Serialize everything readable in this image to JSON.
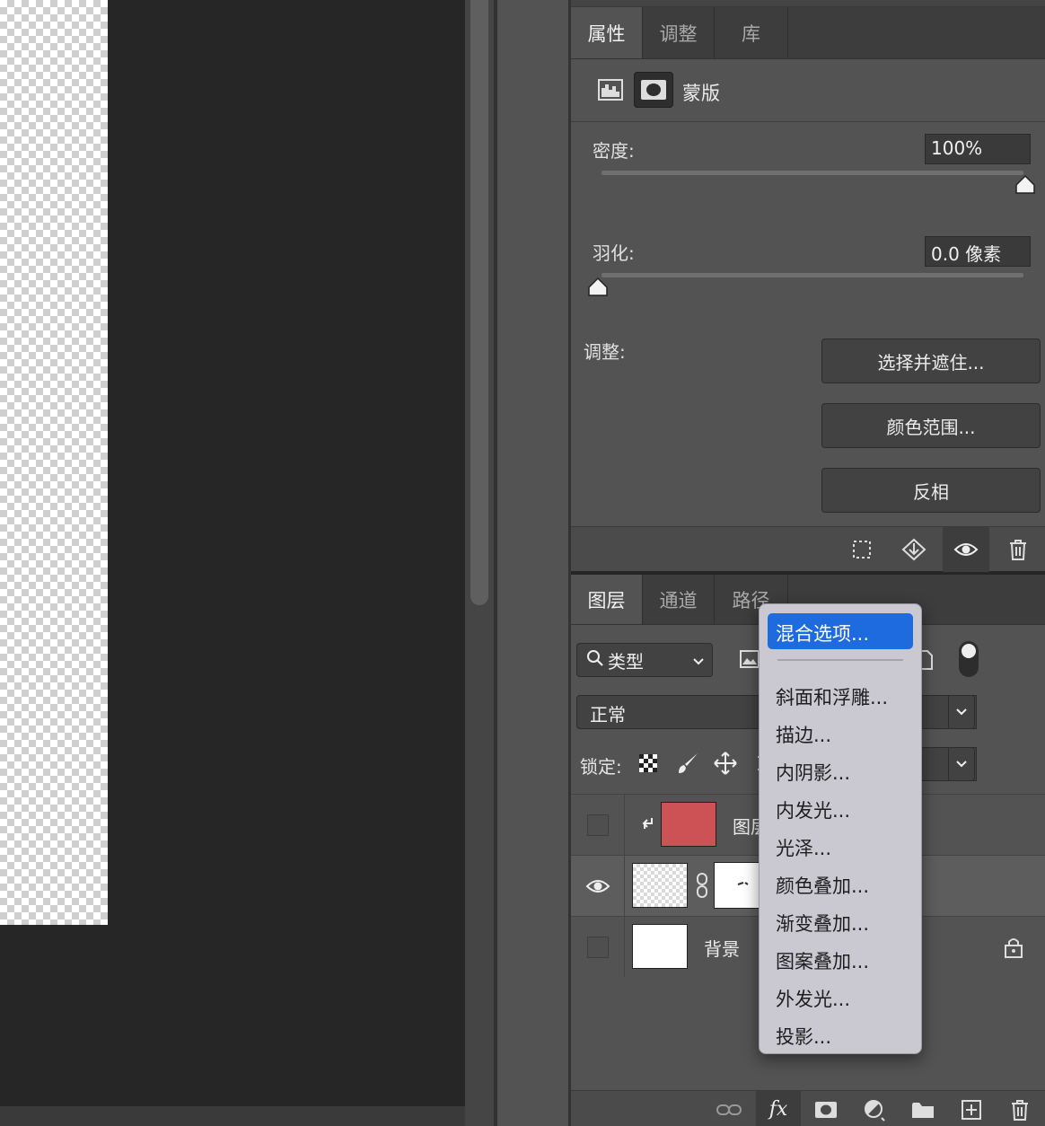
{
  "properties": {
    "tabs": [
      "属性",
      "调整",
      "库"
    ],
    "mode_label": "蒙版",
    "density_label": "密度:",
    "density_value": "100%",
    "density_level": 1.0,
    "feather_label": "羽化:",
    "feather_value": "0.0 像素",
    "feather_level": 0.0,
    "adjust_label": "调整:",
    "buttons": [
      "选择并遮住...",
      "颜色范围...",
      "反相"
    ]
  },
  "layers": {
    "tabs": [
      "图层",
      "通道",
      "路径"
    ],
    "filter_label": "类型",
    "blend_mode": "正常",
    "opacity_suffix": "%",
    "fill_suffix": "%",
    "lock_label": "锁定:",
    "rows": [
      {
        "name": "图层",
        "visible": false,
        "color": "#cc5256"
      },
      {
        "name": "",
        "visible": true
      },
      {
        "name": "背景",
        "visible": false
      }
    ]
  },
  "context_menu": {
    "items": [
      "混合选项...",
      "斜面和浮雕...",
      "描边...",
      "内阴影...",
      "内发光...",
      "光泽...",
      "颜色叠加...",
      "渐变叠加...",
      "图案叠加...",
      "外发光...",
      "投影..."
    ],
    "highlighted": "混合选项..."
  },
  "colors": {
    "accent": "#1e6be0",
    "layer_fill": "#cc5256"
  }
}
